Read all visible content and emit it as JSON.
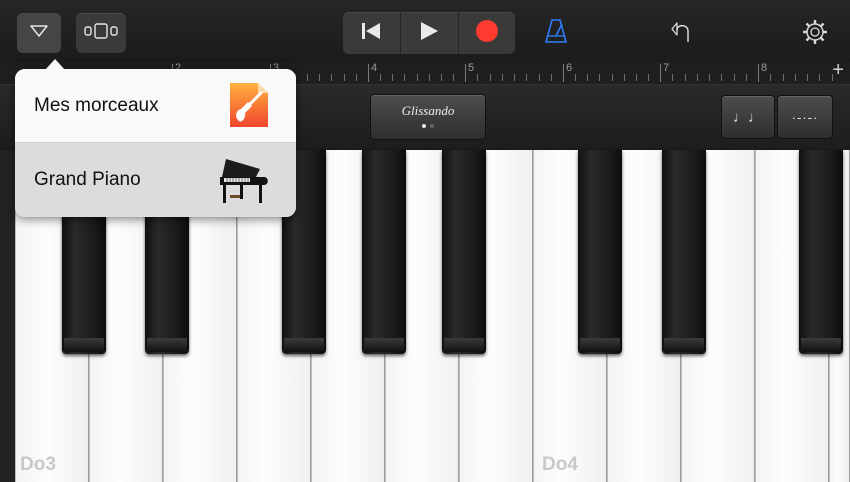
{
  "toolbar": {
    "colors": {
      "record": "#ff3b30",
      "metronome": "#2f7df7"
    },
    "icons": {
      "menu": "triangle-down-icon",
      "view": "tracks-view-icon",
      "rewind": "skip-back-icon",
      "play": "play-icon",
      "record": "record-icon",
      "metronome": "metronome-icon",
      "undo": "undo-icon",
      "settings": "gear-icon"
    }
  },
  "ruler": {
    "bars": [
      "2",
      "3",
      "4",
      "5",
      "6",
      "7",
      "8"
    ],
    "add_label": "+"
  },
  "controls": {
    "glissando_label": "Glissando",
    "glissando_page": 1,
    "glissando_pages": 2,
    "notes_icon": "♩♩",
    "arpeggio_icon": "·-·-·"
  },
  "keyboard": {
    "labels": {
      "c3": "Do3",
      "c4": "Do4"
    }
  },
  "popup": {
    "items": [
      {
        "label": "Mes morceaux",
        "icon": "garageband-file-icon"
      },
      {
        "label": "Grand Piano",
        "icon": "grand-piano-icon",
        "selected": true
      }
    ]
  }
}
